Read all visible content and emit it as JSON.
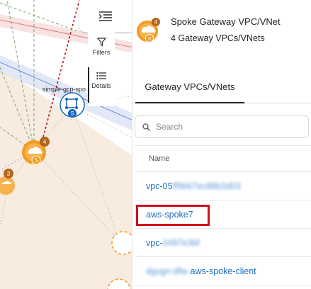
{
  "topology": {
    "node_label": "simple-gcp-spo",
    "spoke_badge_main": "4",
    "spoke_badge_left": "3",
    "node_letter": "S"
  },
  "toolbar": {
    "filters_label": "Filters",
    "details_label": "Details"
  },
  "panel": {
    "title": "Spoke Gateway VPC/VNet",
    "subtitle": "4 Gateway VPCs/VNets",
    "header_badge": "4",
    "header_letter": "S",
    "tab_label": "Gateway VPCs/VNets",
    "search_placeholder": "Search",
    "column_name": "Name",
    "rows": [
      {
        "prefix": "vpc-05",
        "blurred": "ff9b67ec88b3d03",
        "suffix": ""
      },
      {
        "prefix": "aws-spoke7",
        "blurred": "",
        "suffix": ""
      },
      {
        "prefix": "vpc-",
        "blurred": "0497e3bf",
        "suffix": ""
      },
      {
        "prefix": "",
        "blurred": "dgugn-dfw-",
        "suffix": "aws-spoke-client"
      }
    ]
  },
  "colors": {
    "accent_orange": "#f29b1d",
    "link_blue": "#1f6fc0",
    "highlight_red": "#d0111c",
    "node_blue": "#1565c0"
  }
}
